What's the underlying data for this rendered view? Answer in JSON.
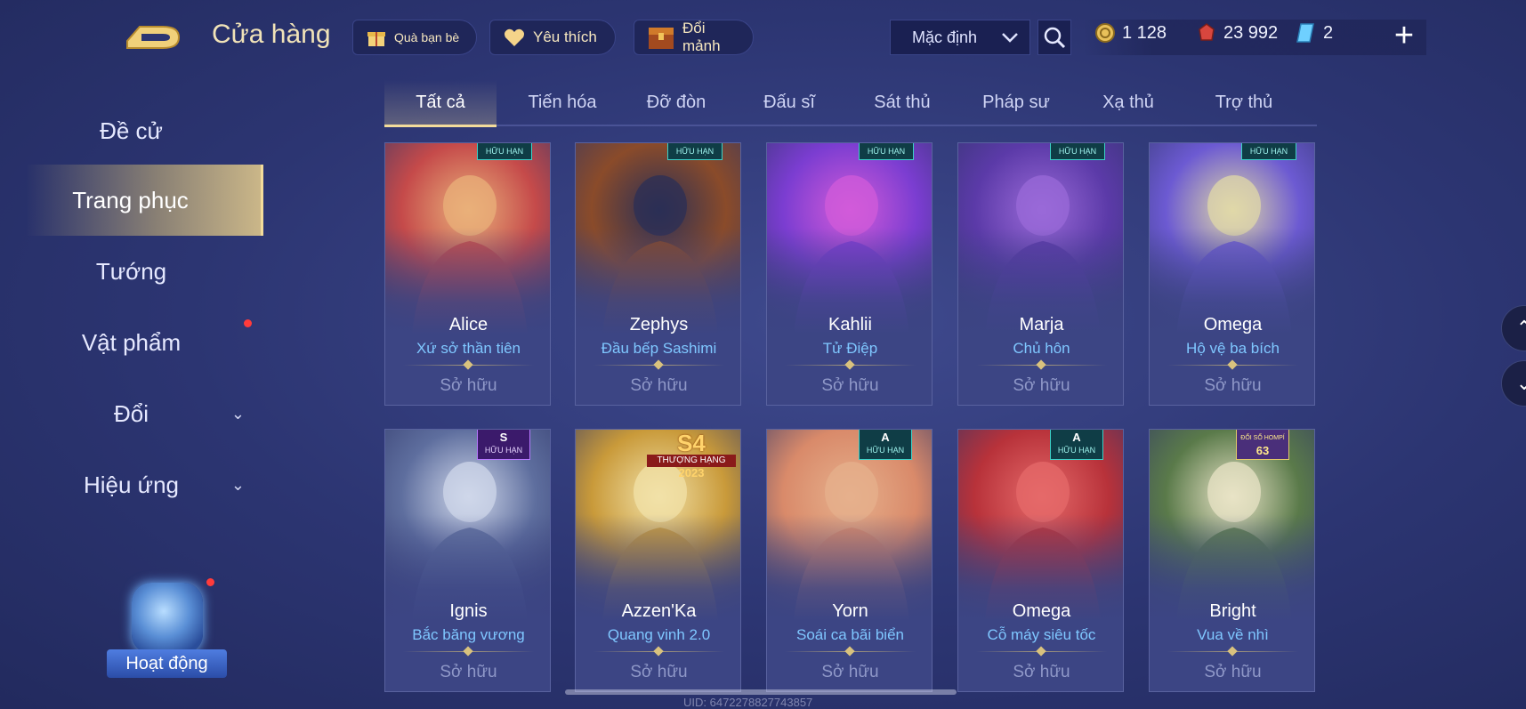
{
  "header": {
    "title": "Cửa hàng",
    "buttons": [
      {
        "label": "Quà bạn bè",
        "icon": "gift-icon"
      },
      {
        "label": "Yêu thích",
        "icon": "heart-icon"
      },
      {
        "label": "Đổi mảnh",
        "icon": "chest-icon"
      }
    ],
    "sort_value": "Mặc định",
    "currencies": [
      {
        "value": "1 128",
        "icon": "gold-coin-icon"
      },
      {
        "value": "23 992",
        "icon": "ruby-icon"
      },
      {
        "value": "2",
        "icon": "crystal-icon"
      }
    ],
    "add_label": "+"
  },
  "sidebar": {
    "items": [
      {
        "label": "Đề cử",
        "active": false
      },
      {
        "label": "Trang phục",
        "active": true
      },
      {
        "label": "Tướng",
        "active": false
      },
      {
        "label": "Vật phẩm",
        "active": false,
        "notification": true
      },
      {
        "label": "Đổi",
        "active": false,
        "expandable": true
      },
      {
        "label": "Hiệu ứng",
        "active": false,
        "expandable": true
      }
    ],
    "event_label": "Hoạt động"
  },
  "tabs": [
    "Tất cả",
    "Tiến hóa",
    "Đỡ đòn",
    "Đấu sĩ",
    "Sát thủ",
    "Pháp sư",
    "Xạ thủ",
    "Trợ thủ"
  ],
  "active_tab": "Tất cả",
  "cards": [
    {
      "hero": "Alice",
      "skin": "Xứ sở thần tiên",
      "status": "Sở hữu",
      "badge": "HỮU HẠN",
      "palette": [
        "#c54a4a",
        "#e9b07a"
      ]
    },
    {
      "hero": "Zephys",
      "skin": "Đầu bếp Sashimi",
      "status": "Sở hữu",
      "badge": "HỮU HẠN",
      "palette": [
        "#8a4b2a",
        "#2b2f55"
      ]
    },
    {
      "hero": "Kahlii",
      "skin": "Tử Điệp",
      "status": "Sở hữu",
      "badge": "HỮU HẠN",
      "palette": [
        "#7b3dd1",
        "#d25bd9"
      ]
    },
    {
      "hero": "Marja",
      "skin": "Chủ hôn",
      "status": "Sở hữu",
      "badge": "HỮU HẠN",
      "palette": [
        "#5b3aa8",
        "#9a6ad8"
      ]
    },
    {
      "hero": "Omega",
      "skin": "Hộ vệ ba bích",
      "status": "Sở hữu",
      "badge": "HỮU HẠN",
      "palette": [
        "#6c5ad2",
        "#e0d8a8"
      ]
    },
    {
      "hero": "Ignis",
      "skin": "Bắc băng vương",
      "status": "Sở hữu",
      "badge": "HỮU HẠN",
      "tier": "S",
      "palette": [
        "#5e6e9e",
        "#cfd7ea"
      ]
    },
    {
      "hero": "Azzen'Ka",
      "skin": "Quang vinh 2.0",
      "status": "Sở hữu",
      "season": "S4",
      "season_sub": "THƯỢNG HẠNG",
      "season_year": "2023",
      "palette": [
        "#c99a3a",
        "#f1e1a8"
      ]
    },
    {
      "hero": "Yorn",
      "skin": "Soái ca bãi biển",
      "status": "Sở hữu",
      "badge": "HỮU HẠN",
      "tier": "A",
      "palette": [
        "#d98a6a",
        "#e6b08c"
      ]
    },
    {
      "hero": "Omega",
      "skin": "Cỗ máy siêu tốc",
      "status": "Sở hữu",
      "badge": "HỮU HẠN",
      "tier": "A",
      "palette": [
        "#b8323a",
        "#e56a6a"
      ]
    },
    {
      "hero": "Bright",
      "skin": "Vua về nhì",
      "status": "Sở hữu",
      "badge": "ĐỔI SỔ HOMPÍ",
      "rank": "63",
      "palette": [
        "#5a7a4a",
        "#e8e3c6"
      ]
    }
  ],
  "uid": "UID: 6472278827743857"
}
